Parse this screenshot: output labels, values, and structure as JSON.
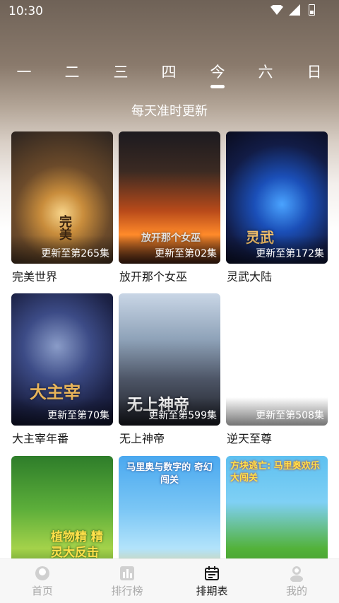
{
  "status_bar": {
    "time": "10:30"
  },
  "days": [
    "一",
    "二",
    "三",
    "四",
    "今",
    "六",
    "日"
  ],
  "selected_day_index": 4,
  "subtitle": "每天准时更新",
  "shows": [
    {
      "title": "完美世界",
      "episode": "更新至第265集",
      "art_text": "完美"
    },
    {
      "title": "放开那个女巫",
      "episode": "更新至第02集",
      "art_text": "放开那个女巫"
    },
    {
      "title": "灵武大陆",
      "episode": "更新至第172集",
      "art_text": "灵武"
    },
    {
      "title": "大主宰年番",
      "episode": "更新至第70集",
      "art_text": "大主宰"
    },
    {
      "title": "无上神帝",
      "episode": "更新至第599集",
      "art_text": "无上神帝"
    },
    {
      "title": "逆天至尊",
      "episode": "更新至第508集",
      "art_text": ""
    },
    {
      "title": "",
      "episode": "",
      "art_text": "植物精 精灵大反击"
    },
    {
      "title": "",
      "episode": "",
      "art_text": "马里奥与数字的 奇幻闯关"
    },
    {
      "title": "",
      "episode": "",
      "art_text": "方块逃亡: 马里奥欢乐大闯关"
    }
  ],
  "bottom_nav": [
    {
      "label": "首页",
      "icon": "home-icon"
    },
    {
      "label": "排行榜",
      "icon": "ranking-icon"
    },
    {
      "label": "排期表",
      "icon": "calendar-icon"
    },
    {
      "label": "我的",
      "icon": "profile-icon"
    }
  ],
  "active_nav_index": 2,
  "colors": {
    "accent": "#1a1a1a",
    "inactive": "#a8a8a8",
    "day_text": "#ffffff"
  }
}
